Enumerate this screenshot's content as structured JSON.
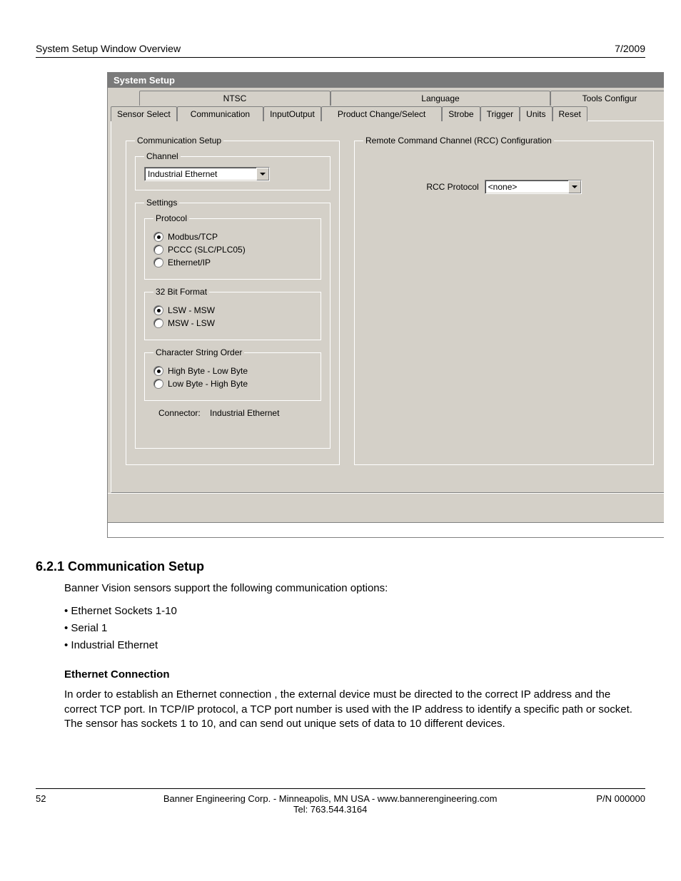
{
  "header": {
    "left": "System Setup Window Overview",
    "right": "7/2009"
  },
  "window": {
    "title": "System Setup",
    "tabs_back": [
      "NTSC",
      "Language",
      "Tools Configur"
    ],
    "tabs_front": [
      "Sensor Select",
      "Communication",
      "InputOutput",
      "Product Change/Select",
      "Strobe",
      "Trigger",
      "Units",
      "Reset"
    ],
    "comm_setup_legend": "Communication Setup",
    "channel_legend": "Channel",
    "channel_value": "Industrial Ethernet",
    "settings_legend": "Settings",
    "protocol_legend": "Protocol",
    "protocol_options": [
      {
        "label": "Modbus/TCP",
        "selected": true
      },
      {
        "label": "PCCC (SLC/PLC05)",
        "selected": false
      },
      {
        "label": "Ethernet/IP",
        "selected": false
      }
    ],
    "bit_format_legend": "32 Bit Format",
    "bit_format_options": [
      {
        "label": "LSW - MSW",
        "selected": true
      },
      {
        "label": "MSW - LSW",
        "selected": false
      }
    ],
    "char_order_legend": "Character String Order",
    "char_order_options": [
      {
        "label": "High Byte - Low Byte",
        "selected": true
      },
      {
        "label": "Low Byte - High Byte",
        "selected": false
      }
    ],
    "connector_label": "Connector:",
    "connector_value": "Industrial Ethernet",
    "rcc_legend": "Remote Command Channel (RCC) Configuration",
    "rcc_label": "RCC Protocol",
    "rcc_value": "<none>"
  },
  "doc": {
    "section_title": "6.2.1 Communication Setup",
    "intro": "Banner Vision sensors support the following communication options:",
    "bullets": [
      "Ethernet Sockets 1-10",
      "Serial 1",
      "Industrial Ethernet"
    ],
    "sub_head": "Ethernet Connection",
    "para": "In order to establish an Ethernet connection , the external device must be directed to the correct IP address and the correct TCP port. In TCP/IP protocol, a TCP port number is used with the IP address to identify a specific path or socket. The sensor has sockets 1 to 10, and can send out unique sets of data to 10 different devices."
  },
  "footer": {
    "page": "52",
    "center1": "Banner Engineering Corp. - Minneapolis, MN USA - www.bannerengineering.com",
    "center2": "Tel: 763.544.3164",
    "pn": "P/N 000000"
  }
}
